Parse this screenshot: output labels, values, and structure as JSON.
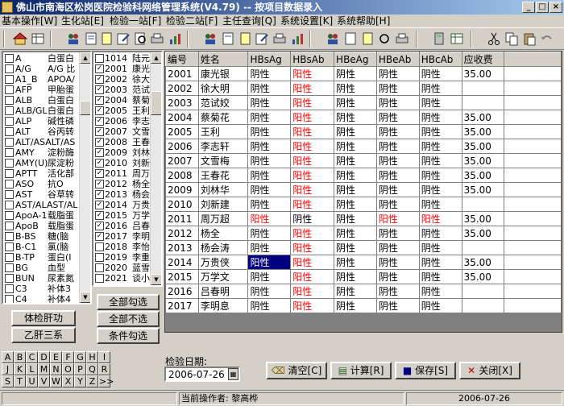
{
  "window": {
    "title": "佛山市南海区松岗医院检验科网络管理系统(V4.79) -- 按项目数据录入"
  },
  "menu": [
    "基本操作[W]",
    "生化站[E]",
    "检验一站[F]",
    "检验二站[F]",
    "主任查询[Q]",
    "系统设置[K]",
    "系统帮助[H]"
  ],
  "items_list": [
    {
      "code": "A",
      "name": "白蛋白"
    },
    {
      "code": "A/G",
      "name": "A/G 比"
    },
    {
      "code": "A1_B",
      "name": "APOA/"
    },
    {
      "code": "AFP",
      "name": "甲胎蛋"
    },
    {
      "code": "ALB",
      "name": "白蛋白"
    },
    {
      "code": "ALB/GL",
      "name": "白蛋白"
    },
    {
      "code": "ALP",
      "name": "碱性磷"
    },
    {
      "code": "ALT",
      "name": "谷丙转"
    },
    {
      "code": "ALT/ASALT/AS",
      "name": ""
    },
    {
      "code": "AMY",
      "name": "淀粉酶"
    },
    {
      "code": "AMY(U)",
      "name": "尿淀粉"
    },
    {
      "code": "APTT",
      "name": "活化部"
    },
    {
      "code": "ASO",
      "name": "抗O"
    },
    {
      "code": "AST",
      "name": "谷草转"
    },
    {
      "code": "AST/ALAST/AL",
      "name": ""
    },
    {
      "code": "ApoA-1",
      "name": "载脂蛋"
    },
    {
      "code": "ApoB",
      "name": "载脂蛋"
    },
    {
      "code": "B-BS",
      "name": "糖(脑"
    },
    {
      "code": "B-C1",
      "name": "氯(脑"
    },
    {
      "code": "B-TP",
      "name": "蛋白(I"
    },
    {
      "code": "BG",
      "name": "血型"
    },
    {
      "code": "BUN",
      "name": "尿素氮"
    },
    {
      "code": "C3",
      "name": "补体3"
    },
    {
      "code": "C4",
      "name": "补体4"
    }
  ],
  "sample_list": [
    {
      "no": "1014",
      "name": "陆元",
      "checked": false
    },
    {
      "no": "2001",
      "name": "康光",
      "checked": true
    },
    {
      "no": "2002",
      "name": "徐大",
      "checked": true
    },
    {
      "no": "2003",
      "name": "范试",
      "checked": true
    },
    {
      "no": "2004",
      "name": "蔡菊",
      "checked": true
    },
    {
      "no": "2005",
      "name": "王利",
      "checked": true
    },
    {
      "no": "2006",
      "name": "李志",
      "checked": true
    },
    {
      "no": "2007",
      "name": "文雪",
      "checked": true
    },
    {
      "no": "2008",
      "name": "王春",
      "checked": true
    },
    {
      "no": "2009",
      "name": "刘林",
      "checked": true
    },
    {
      "no": "2010",
      "name": "刘新",
      "checked": true
    },
    {
      "no": "2011",
      "name": "周万",
      "checked": true
    },
    {
      "no": "2012",
      "name": "杨全",
      "checked": true
    },
    {
      "no": "2013",
      "name": "杨会",
      "checked": true
    },
    {
      "no": "2014",
      "name": "万贵",
      "checked": true
    },
    {
      "no": "2015",
      "name": "万学",
      "checked": true
    },
    {
      "no": "2016",
      "name": "吕春",
      "checked": true
    },
    {
      "no": "2017",
      "name": "李明",
      "checked": true
    },
    {
      "no": "2018",
      "name": "李怡",
      "checked": false
    },
    {
      "no": "2019",
      "name": "李重",
      "checked": false
    },
    {
      "no": "2020",
      "name": "蓝雪",
      "checked": false
    },
    {
      "no": "2021",
      "name": "谈小",
      "checked": false
    }
  ],
  "buttons": {
    "exam_liver": "体检肝功",
    "hep_b": "乙肝三系",
    "select_all": "全部勾选",
    "deselect_all": "全部不选",
    "select_cond": "条件勾选",
    "clear": "清空[C]",
    "calc": "计算[R]",
    "save": "保存[S]",
    "close": "关闭[X]"
  },
  "table": {
    "headers": [
      "编号",
      "姓名",
      "HBsAg",
      "HBsAb",
      "HBeAg",
      "HBeAb",
      "HBcAb",
      "应收费"
    ],
    "rows": [
      [
        "2001",
        "康光银",
        "阴性",
        "阳性",
        "阴性",
        "阴性",
        "阴性",
        "35.00"
      ],
      [
        "2002",
        "徐大明",
        "阴性",
        "阳性",
        "阴性",
        "阴性",
        "阴性",
        ""
      ],
      [
        "2003",
        "范试姣",
        "阴性",
        "阳性",
        "阴性",
        "阴性",
        "阴性",
        ""
      ],
      [
        "2004",
        "蔡菊花",
        "阴性",
        "阳性",
        "阴性",
        "阴性",
        "阴性",
        "35.00"
      ],
      [
        "2005",
        "王利",
        "阴性",
        "阳性",
        "阴性",
        "阴性",
        "阴性",
        "35.00"
      ],
      [
        "2006",
        "李志轩",
        "阴性",
        "阳性",
        "阴性",
        "阴性",
        "阴性",
        "35.00"
      ],
      [
        "2007",
        "文雪梅",
        "阴性",
        "阳性",
        "阴性",
        "阴性",
        "阴性",
        "35.00"
      ],
      [
        "2008",
        "王春花",
        "阴性",
        "阳性",
        "阴性",
        "阴性",
        "阴性",
        "35.00"
      ],
      [
        "2009",
        "刘林华",
        "阴性",
        "阳性",
        "阴性",
        "阴性",
        "阴性",
        "35.00"
      ],
      [
        "2010",
        "刘新建",
        "阴性",
        "阳性",
        "阴性",
        "阴性",
        "阴性",
        ""
      ],
      [
        "2011",
        "周万超",
        "阳性",
        "阴性",
        "阴性",
        "阳性",
        "阳性",
        "35.00"
      ],
      [
        "2012",
        "杨全",
        "阴性",
        "阳性",
        "阴性",
        "阴性",
        "阴性",
        "35.00"
      ],
      [
        "2013",
        "杨会涛",
        "阴性",
        "阳性",
        "阴性",
        "阴性",
        "阴性",
        ""
      ],
      [
        "2014",
        "万贵侠",
        "阳性",
        "阳性",
        "阴性",
        "阴性",
        "阴性",
        "35.00"
      ],
      [
        "2015",
        "万学文",
        "阴性",
        "阳性",
        "阴性",
        "阴性",
        "阴性",
        "35.00"
      ],
      [
        "2016",
        "吕春明",
        "阴性",
        "阳性",
        "阴性",
        "阴性",
        "阴性",
        ""
      ],
      [
        "2017",
        "李明息",
        "阴性",
        "阳性",
        "阴性",
        "阴性",
        "阴性",
        ""
      ]
    ]
  },
  "alphabet": [
    "A",
    "B",
    "C",
    "D",
    "E",
    "F",
    "G",
    "H",
    "I",
    "J",
    "K",
    "L",
    "M",
    "N",
    "O",
    "P",
    "Q",
    "R",
    "S",
    "T",
    "U",
    "V",
    "W",
    "X",
    "Y",
    "Z",
    ">>"
  ],
  "date": {
    "label": "检验日期:",
    "value": "2006-07-26"
  },
  "status": {
    "operator": "当前操作者: 黎高桦",
    "date": "2006-07-26"
  },
  "colors": {
    "positive": "#ff0000",
    "title_from": "#0a246a",
    "title_to": "#a6caf0",
    "selected": "#000080"
  }
}
